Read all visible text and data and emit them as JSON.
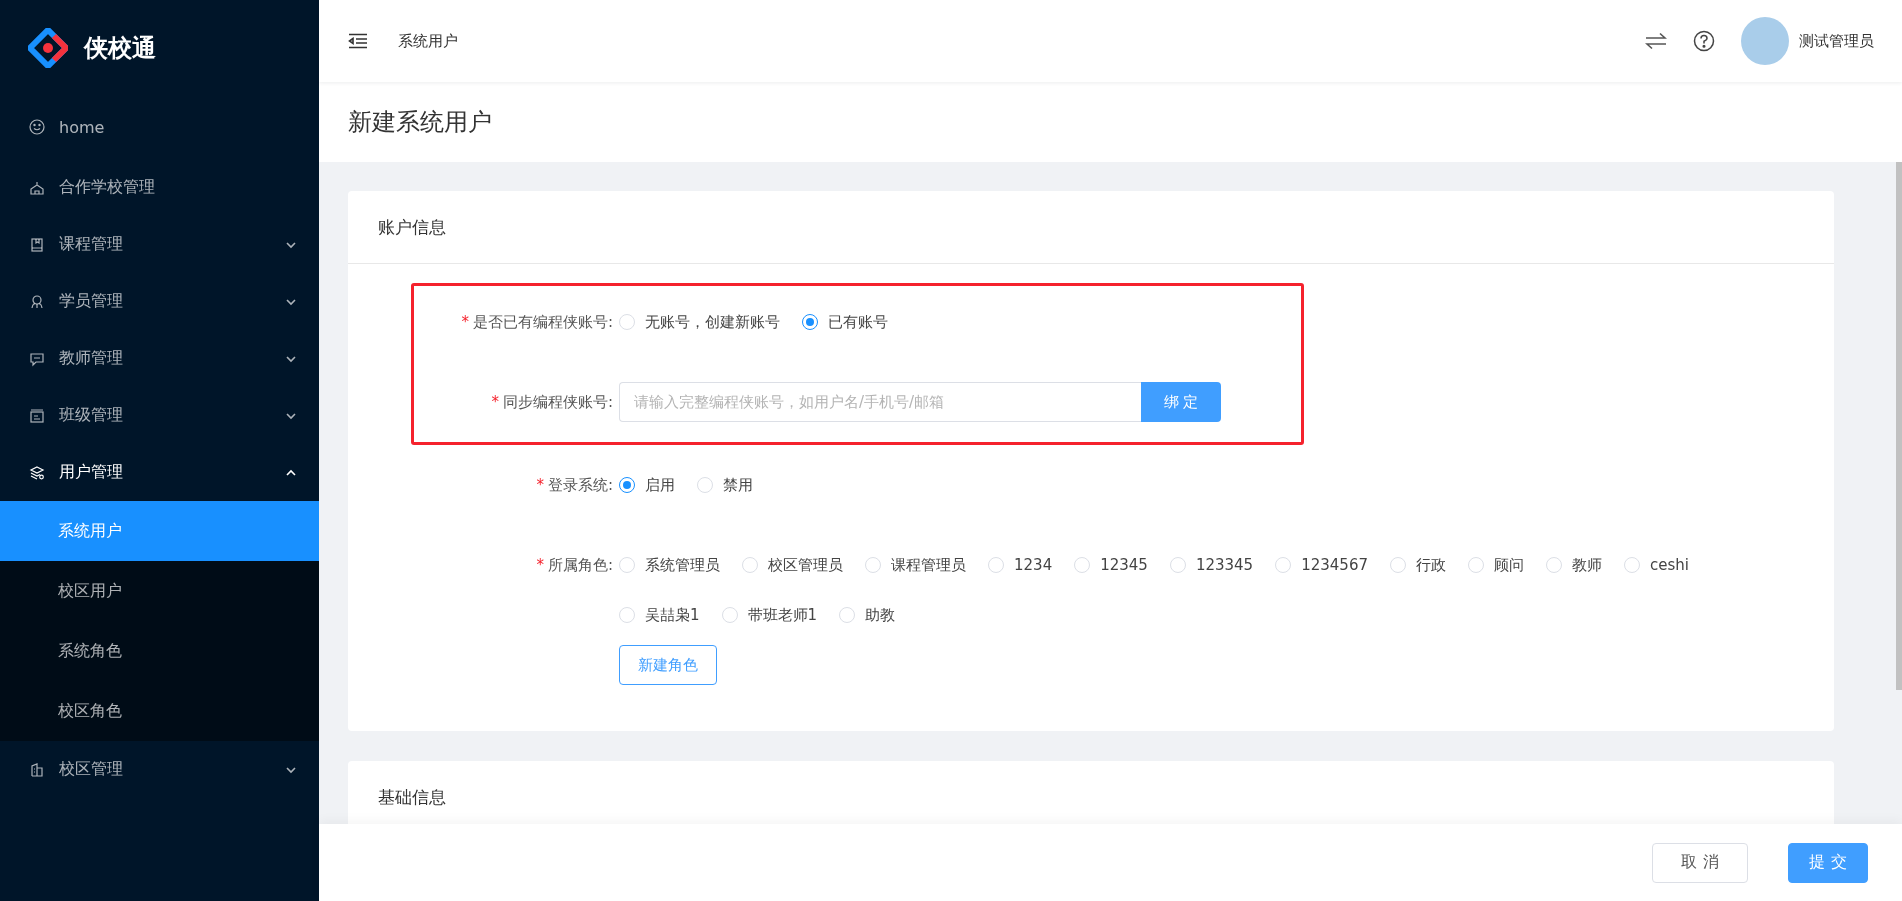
{
  "app": {
    "name": "侠校通"
  },
  "sidebar": {
    "items": [
      {
        "kind": "link",
        "label": "home"
      },
      {
        "kind": "link",
        "label": "合作学校管理"
      },
      {
        "kind": "group",
        "label": "课程管理",
        "expanded": false
      },
      {
        "kind": "group",
        "label": "学员管理",
        "expanded": false
      },
      {
        "kind": "group",
        "label": "教师管理",
        "expanded": false
      },
      {
        "kind": "group",
        "label": "班级管理",
        "expanded": false
      },
      {
        "kind": "group",
        "label": "用户管理",
        "expanded": true,
        "children": [
          {
            "label": "系统用户",
            "selected": true
          },
          {
            "label": "校区用户",
            "selected": false
          },
          {
            "label": "系统角色",
            "selected": false
          },
          {
            "label": "校区角色",
            "selected": false
          }
        ]
      },
      {
        "kind": "group",
        "label": "校区管理",
        "expanded": false
      }
    ]
  },
  "header": {
    "breadcrumb": "系统用户",
    "user": "测试管理员"
  },
  "page": {
    "title": "新建系统用户"
  },
  "account_section": {
    "title": "账户信息",
    "fields": [
      {
        "kind": "radio",
        "required_mark": "*",
        "label": "是否已有编程侠账号:",
        "highlighted": true,
        "options": [
          {
            "label": "无账号，创建新账号",
            "selected": false
          },
          {
            "label": "已有账号",
            "selected": true
          }
        ]
      },
      {
        "kind": "input",
        "required_mark": "*",
        "label": "同步编程侠账号:",
        "highlighted": true,
        "placeholder": "请输入完整编程侠账号，如用户名/手机号/邮箱",
        "button": "绑 定"
      },
      {
        "kind": "radio",
        "required_mark": "*",
        "label": "登录系统:",
        "highlighted": false,
        "options": [
          {
            "label": "启用",
            "selected": true
          },
          {
            "label": "禁用",
            "selected": false
          }
        ]
      },
      {
        "kind": "radio",
        "required_mark": "*",
        "label": "所属角色:",
        "highlighted": false,
        "button": "新建角色",
        "options": [
          {
            "label": "系统管理员",
            "selected": false
          },
          {
            "label": "校区管理员",
            "selected": false
          },
          {
            "label": "课程管理员",
            "selected": false
          },
          {
            "label": "1234",
            "selected": false
          },
          {
            "label": "12345",
            "selected": false
          },
          {
            "label": "123345",
            "selected": false
          },
          {
            "label": "1234567",
            "selected": false
          },
          {
            "label": "行政",
            "selected": false
          },
          {
            "label": "顾问",
            "selected": false
          },
          {
            "label": "教师",
            "selected": false
          },
          {
            "label": "ceshi",
            "selected": false
          },
          {
            "label": "吴喆枭1",
            "selected": false
          },
          {
            "label": "带班老师1",
            "selected": false
          },
          {
            "label": "助教",
            "selected": false
          }
        ]
      }
    ]
  },
  "basic_section": {
    "title": "基础信息"
  },
  "footer": {
    "buttons": [
      {
        "label": "取 消",
        "kind": "default"
      },
      {
        "label": "提 交",
        "kind": "primary"
      }
    ]
  }
}
